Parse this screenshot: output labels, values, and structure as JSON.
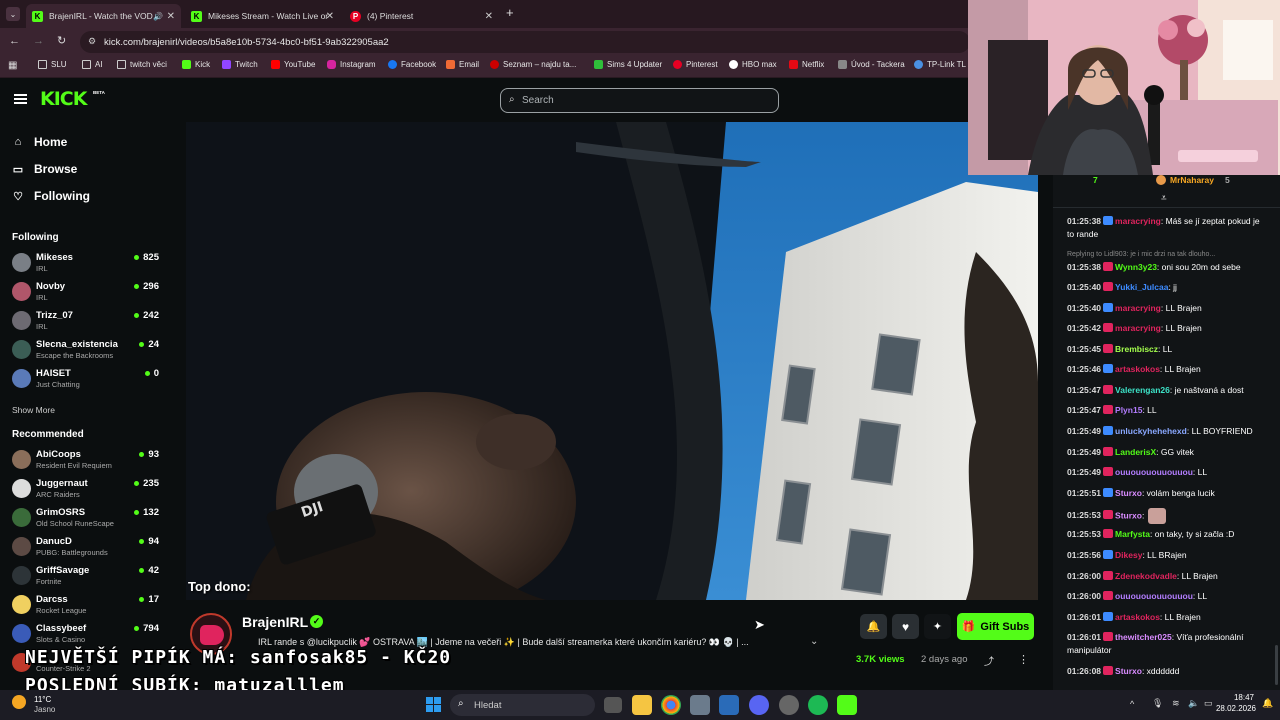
{
  "browser": {
    "tabs": [
      {
        "title": "BrajenIRL - Watch the VOD"
      },
      {
        "title": "Mikeses Stream - Watch Live or"
      },
      {
        "title": "(4) Pinterest"
      }
    ],
    "url": "kick.com/brajenirl/videos/b5a8e10b-5734-4bc0-bf51-9ab322905aa2",
    "bookmarks": [
      "SLU",
      "AI",
      "twitch věci",
      "Kick",
      "Twitch",
      "YouTube",
      "Instagram",
      "Facebook",
      "Email",
      "Seznam – najdu ta...",
      "Sims 4 Updater",
      "Pinterest",
      "HBO max",
      "Netflix",
      "Úvod - Tackera",
      "TP-Link TL"
    ]
  },
  "header": {
    "logo": "KICK",
    "beta": "BETA",
    "search_placeholder": "Search"
  },
  "nav": {
    "home": "Home",
    "browse": "Browse",
    "following": "Following"
  },
  "sidebar": {
    "following_title": "Following",
    "following": [
      {
        "name": "Mikeses",
        "category": "IRL",
        "viewers": "825"
      },
      {
        "name": "Novby",
        "category": "IRL",
        "viewers": "296"
      },
      {
        "name": "Trizz_07",
        "category": "IRL",
        "viewers": "242"
      },
      {
        "name": "Slecna_existencia",
        "category": "Escape the Backrooms",
        "viewers": "24"
      },
      {
        "name": "HAISET",
        "category": "Just Chatting",
        "viewers": "0"
      }
    ],
    "show_more": "Show More",
    "recommended_title": "Recommended",
    "recommended": [
      {
        "name": "AbiCoops",
        "category": "Resident Evil Requiem",
        "viewers": "93"
      },
      {
        "name": "Juggernaut",
        "category": "ARC Raiders",
        "viewers": "235"
      },
      {
        "name": "GrimOSRS",
        "category": "Old School RuneScape",
        "viewers": "132"
      },
      {
        "name": "DanucD",
        "category": "PUBG: Battlegrounds",
        "viewers": "94"
      },
      {
        "name": "GriffSavage",
        "category": "Fortnite",
        "viewers": "42"
      },
      {
        "name": "Darcss",
        "category": "Rocket League",
        "viewers": "17"
      },
      {
        "name": "Classybeef",
        "category": "Slots & Casino",
        "viewers": "794"
      },
      {
        "name": "",
        "category": "Counter-Strike 2",
        "viewers": ""
      }
    ]
  },
  "video": {
    "overlay_text": "Top dono:"
  },
  "stream": {
    "channel": "BrajenIRL",
    "title": "IRL rande s @lucikpuclik 💕 OSTRAVA 🏙️ | Jdeme na večeři ✨ | Bude další streamerka které ukončím kariéru? 👀 💀 | ...",
    "views": "3.7K views",
    "age": "2 days ago",
    "gift_label": "Gift Subs"
  },
  "overlay": {
    "top_sub": "NEJVĚTŠÍ PIPÍK MÁ: sanfosak85 - KČ20",
    "last_sub": "POSLEDNÍ SUBÍK: matuzalllem"
  },
  "chat": {
    "top_users": [
      "7",
      "MrNaharay",
      "5"
    ],
    "reply_context": "Replying to Lidl903: je i mic drzi na tak dlouho...",
    "messages": [
      {
        "time": "01:25:38",
        "user": "maracrying",
        "text": ": Máš se jí zeptat pokud je to rande",
        "color": "#e0245e"
      },
      {
        "time": "01:25:38",
        "user": "Wynn3y23",
        "text": ": oni sou 20m od sebe",
        "color": "#53fc18"
      },
      {
        "time": "01:25:40",
        "user": "Yukki_Julcaa",
        "text": ": jj",
        "color": "#3d8bff"
      },
      {
        "time": "01:25:40",
        "user": "maracrying",
        "text": ": LL Brajen",
        "color": "#e0245e"
      },
      {
        "time": "01:25:42",
        "user": "maracrying",
        "text": ": LL Brajen",
        "color": "#e0245e"
      },
      {
        "time": "01:25:45",
        "user": "Brembiscz",
        "text": ": LL",
        "color": "#a4ff4d"
      },
      {
        "time": "01:25:46",
        "user": "artaskokos",
        "text": ": LL Brajen",
        "color": "#e0245e"
      },
      {
        "time": "01:25:47",
        "user": "Valerengan26",
        "text": ": je naštvaná a dost",
        "color": "#3de3c8"
      },
      {
        "time": "01:25:47",
        "user": "Plyn15",
        "text": ": LL",
        "color": "#b37dff"
      },
      {
        "time": "01:25:49",
        "user": "unluckyhehehexd",
        "text": ": LL BOYFRIEND",
        "color": "#8aa8ff"
      },
      {
        "time": "01:25:49",
        "user": "LanderisX",
        "text": ": GG vitek",
        "color": "#53fc18"
      },
      {
        "time": "01:25:49",
        "user": "ouuouououuouuou",
        "text": ": LL",
        "color": "#b37dff"
      },
      {
        "time": "01:25:51",
        "user": "Sturxo",
        "text": ": volám benga lucik",
        "color": "#d98cff"
      },
      {
        "time": "01:25:53",
        "user": "Sturxo",
        "text": ":",
        "color": "#d98cff"
      },
      {
        "time": "01:25:53",
        "user": "Marfysta",
        "text": ": on taky, ty si začla :D",
        "color": "#53fc18"
      },
      {
        "time": "01:25:56",
        "user": "Dikesy",
        "text": ": LL BRajen",
        "color": "#e0245e"
      },
      {
        "time": "01:26:00",
        "user": "Zdenekodvadle",
        "text": ": LL Brajen",
        "color": "#e0245e"
      },
      {
        "time": "01:26:00",
        "user": "ouuouououuouuou",
        "text": ": LL",
        "color": "#b37dff"
      },
      {
        "time": "01:26:01",
        "user": "artaskokos",
        "text": ": LL Brajen",
        "color": "#e0245e"
      },
      {
        "time": "01:26:01",
        "user": "thewitcher025",
        "text": ": Víťa profesionální manipulátor",
        "color": "#d98cff"
      },
      {
        "time": "01:26:08",
        "user": "Sturxo",
        "text": ": xdddddd",
        "color": "#d98cff"
      }
    ]
  },
  "taskbar": {
    "weather_temp": "11°C",
    "weather_text": "Jasno",
    "search_placeholder": "Hledat",
    "time": "18:47",
    "date": "28.02.2026"
  }
}
